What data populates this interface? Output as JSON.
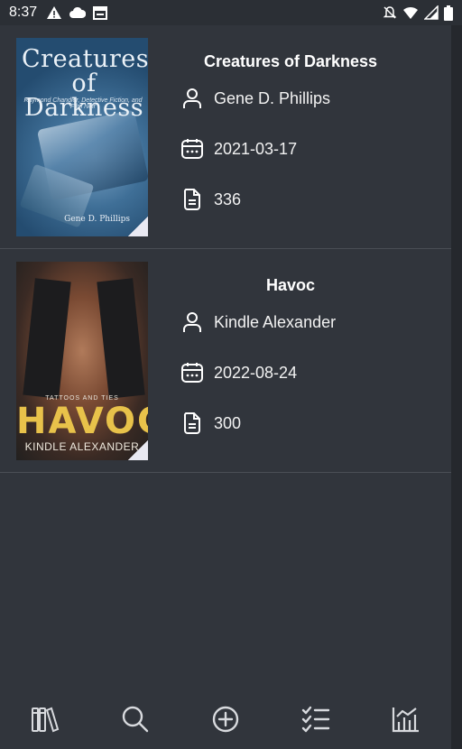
{
  "status_bar": {
    "time": "8:37",
    "left_icons": [
      "warning-icon",
      "cloud-icon",
      "calendar-icon"
    ],
    "right_icons": [
      "notifications-off-icon",
      "wifi-icon",
      "signal-icon",
      "battery-icon"
    ]
  },
  "books": [
    {
      "title": "Creatures of Darkness",
      "author": "Gene D. Phillips",
      "date": "2021-03-17",
      "pages": "336",
      "cover": {
        "title": "Creatures of Darkness",
        "subtitle": "Raymond Chandler, Detective Fiction, and Film Noir",
        "author": "Gene D. Phillips"
      }
    },
    {
      "title": "Havoc",
      "author": "Kindle Alexander",
      "date": "2022-08-24",
      "pages": "300",
      "cover": {
        "series": "TATTOOS AND TIES",
        "title": "HAVOC",
        "author": "KINDLE ALEXANDER"
      }
    }
  ],
  "bottom_nav": {
    "items": [
      "library-icon",
      "search-icon",
      "add-icon",
      "checklist-icon",
      "stats-icon"
    ]
  },
  "colors": {
    "background": "#31353c",
    "status_bar": "#2b2f35",
    "divider": "#4a4e55",
    "text": "#ffffff"
  }
}
